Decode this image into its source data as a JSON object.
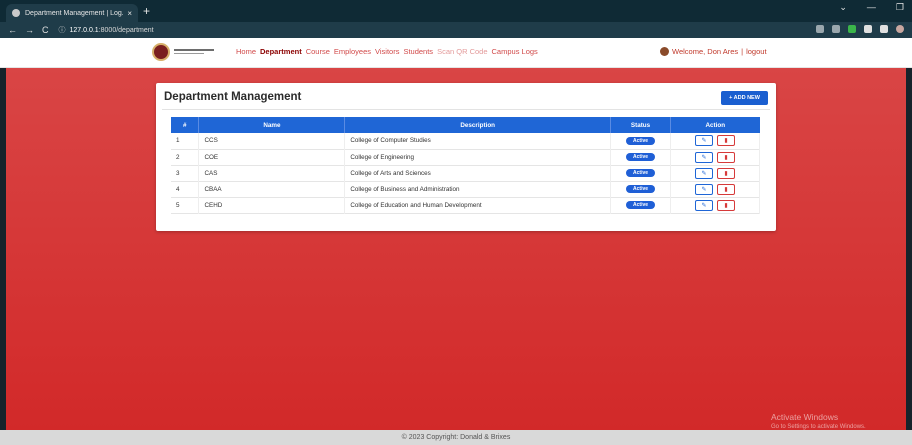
{
  "browser": {
    "tab_title": "Department Management | Log...",
    "tab_close": "×",
    "new_tab": "+",
    "url_host": "127.0.0.1",
    "url_path": ":8000/department",
    "window_controls": [
      "⌄",
      "—",
      "❐"
    ]
  },
  "nav": {
    "links": [
      "Home",
      "Department",
      "Course",
      "Employees",
      "Visitors",
      "Students",
      "Scan QR Code",
      "Campus Logs"
    ],
    "active": "Department",
    "user_greeting": "Welcome, Don Ares",
    "separator": "|",
    "logout": "logout"
  },
  "card": {
    "title": "Department Management",
    "add_button": "+ ADD NEW"
  },
  "table": {
    "headers": [
      "#",
      "Name",
      "Description",
      "Status",
      "Action"
    ],
    "rows": [
      {
        "num": "1",
        "name": "CCS",
        "description": "College of Computer Studies",
        "status": "Active"
      },
      {
        "num": "2",
        "name": "COE",
        "description": "College of Engineering",
        "status": "Active"
      },
      {
        "num": "3",
        "name": "CAS",
        "description": "College of Arts and Sciences",
        "status": "Active"
      },
      {
        "num": "4",
        "name": "CBAA",
        "description": "College of Business and Administration",
        "status": "Active"
      },
      {
        "num": "5",
        "name": "CEHD",
        "description": "College of Education and Human Development",
        "status": "Active"
      }
    ]
  },
  "footer": {
    "text": "© 2023 Copyright: Donald & Brixes"
  },
  "watermark": {
    "line1": "Activate Windows",
    "line2": "Go to Settings to activate Windows."
  },
  "colors": {
    "primary": "#1f66d6",
    "danger": "#d63a3a",
    "background": "#d22929"
  }
}
